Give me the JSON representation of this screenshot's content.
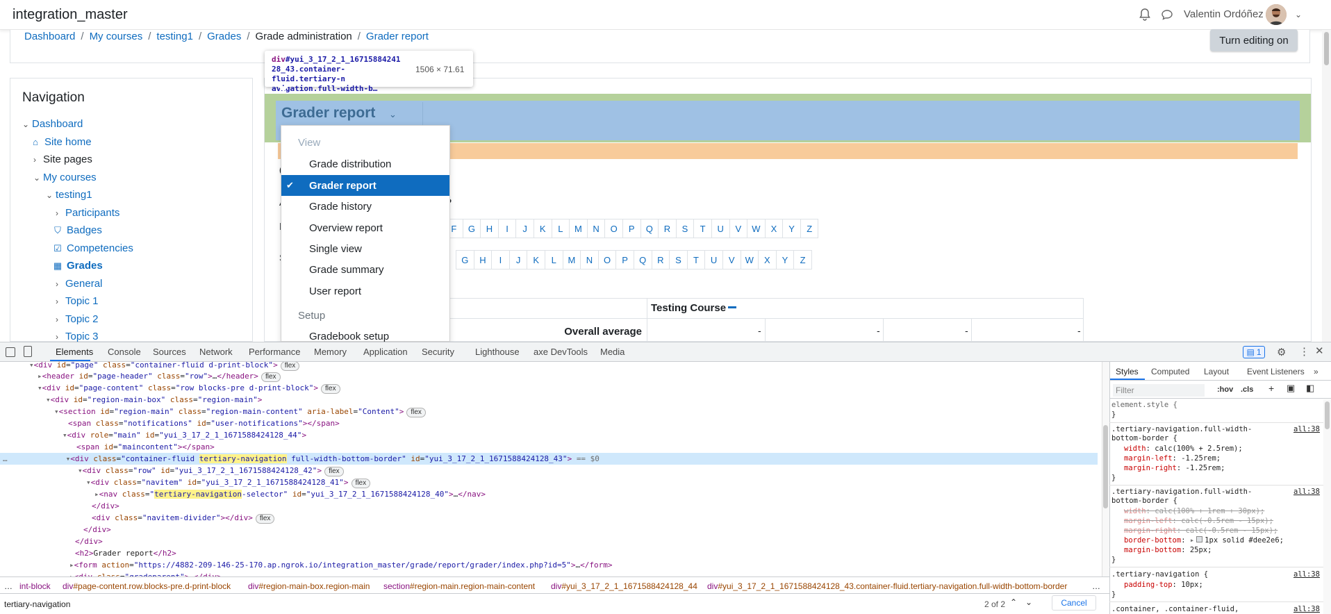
{
  "header": {
    "site_name": "integration_master",
    "user_name": "Valentin Ordóñez"
  },
  "breadcrumb": [
    "Dashboard",
    "My courses",
    "testing1",
    "Grades",
    "Grade administration",
    "Grader report"
  ],
  "turn_editing": "Turn editing on",
  "navigation": {
    "title": "Navigation",
    "items": [
      "Dashboard",
      "Site home",
      "Site pages",
      "My courses",
      "testing1",
      "Participants",
      "Badges",
      "Competencies",
      "Grades",
      "General",
      "Topic 1",
      "Topic 2",
      "Topic 3"
    ]
  },
  "tooltip": {
    "element_tag": "div",
    "element_id": "#yui_3_17_2_1_16715884241",
    "element_id2": "28_43",
    "element_class": ".container-fluid.tertiary-n",
    "element_class2": "avigation.full-width-b…",
    "size": "1506 × 71.61"
  },
  "tertiary": {
    "title": "Grader report"
  },
  "dropdown": {
    "view_header": "View",
    "items": [
      "Grade distribution",
      "Grader report",
      "Grade history",
      "Overview report",
      "Single view",
      "Grade summary",
      "User report"
    ],
    "selected": "Grader report",
    "setup_header": "Setup",
    "setup_items": [
      "Gradebook setup"
    ]
  },
  "letters_row1": [
    "F",
    "G",
    "H",
    "I",
    "J",
    "K",
    "L",
    "M",
    "N",
    "O",
    "P",
    "Q",
    "R",
    "S",
    "T",
    "U",
    "V",
    "W",
    "X",
    "Y",
    "Z"
  ],
  "letters_row2": [
    "G",
    "H",
    "I",
    "J",
    "K",
    "L",
    "M",
    "N",
    "O",
    "P",
    "Q",
    "R",
    "S",
    "T",
    "U",
    "V",
    "W",
    "X",
    "Y",
    "Z"
  ],
  "partial_text": {
    "c": "C",
    "a": "A",
    "p": "P",
    "f": "F",
    "s": "S"
  },
  "grade_table": {
    "course": "Testing Course",
    "row_label": "Overall average",
    "values": [
      "-",
      "-",
      "-",
      "-"
    ]
  },
  "devtools": {
    "tabs": [
      "Elements",
      "Console",
      "Sources",
      "Network",
      "Performance",
      "Memory",
      "Application",
      "Security",
      "Lighthouse",
      "axe DevTools",
      "Media"
    ],
    "issues_count": "1",
    "styles_tabs": [
      "Styles",
      "Computed",
      "Layout",
      "Event Listeners"
    ],
    "filter_placeholder": "Filter",
    "hov": ":hov",
    "cls": ".cls",
    "search_value": "tertiary-navigation",
    "search_count": "2 of 2",
    "cancel": "Cancel",
    "selected_suffix": "== $0",
    "flex_badge": "flex",
    "crumbs": [
      {
        "tag": "int-block",
        "cls": ""
      },
      {
        "tag": "div",
        "cls": "#page-content.row.blocks-pre.d-print-block"
      },
      {
        "tag": "div",
        "cls": "#region-main-box.region-main"
      },
      {
        "tag": "section",
        "cls": "#region-main.region-main-content"
      },
      {
        "tag": "div",
        "cls": "#yui_3_17_2_1_1671588424128_44"
      },
      {
        "tag": "div",
        "cls": "#yui_3_17_2_1_1671588424128_43.container-fluid.tertiary-navigation.full-width-bottom-border"
      }
    ],
    "styles": {
      "element_style": "element.style {",
      "close": "}",
      "source": "all:38",
      "rule1_sel_a": ".tertiary-navigation.full-width-",
      "rule1_sel_b": "bottom-border {",
      "rule1_p1": "width",
      "rule1_v1": "calc(100% + 2.5rem);",
      "rule1_p2": "margin-left",
      "rule1_v2": "-1.25rem;",
      "rule1_p3": "margin-right",
      "rule1_v3": "-1.25rem;",
      "rule2_p1": "width",
      "rule2_v1": "calc(100% + 1rem + 30px);",
      "rule2_p2": "margin-left",
      "rule2_v2": "calc(-0.5rem - 15px);",
      "rule2_p3": "margin-right",
      "rule2_v3": "calc(-0.5rem - 15px);",
      "rule2_p4": "border-bottom",
      "rule2_v4": "1px solid #dee2e6;",
      "rule2_p5": "margin-bottom",
      "rule2_v5": "25px;",
      "rule3_sel": ".tertiary-navigation {",
      "rule3_p1": "padding-top",
      "rule3_v1": "10px;",
      "rule4_sel": ".container, .container-fluid,"
    }
  },
  "colors": {
    "accent": "#0f6cbf",
    "highlight_blue": "#9fc1e4",
    "highlight_green": "#b5d19b",
    "highlight_orange": "#f8cb9a"
  }
}
